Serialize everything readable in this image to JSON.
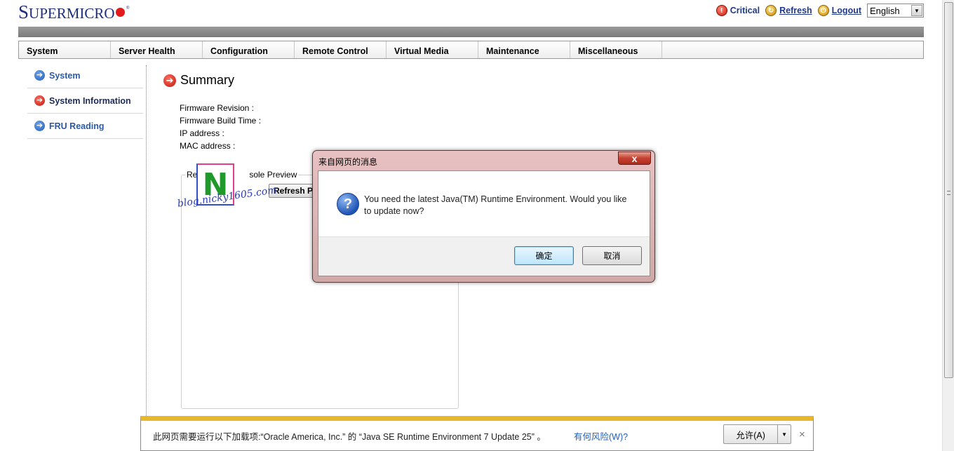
{
  "brand": {
    "letter_s": "S",
    "rest": "UPERMICRO",
    "reg": "®"
  },
  "topbar": {
    "critical": "Critical",
    "refresh": "Refresh",
    "logout": "Logout",
    "language": "English"
  },
  "nav": [
    "System",
    "Server Health",
    "Configuration",
    "Remote Control",
    "Virtual Media",
    "Maintenance",
    "Miscellaneous"
  ],
  "sidebar": [
    {
      "label": "System",
      "icon": "arrow-right-circle-blue-icon"
    },
    {
      "label": "System Information",
      "icon": "arrow-right-circle-red-icon"
    },
    {
      "label": "FRU Reading",
      "icon": "arrow-right-circle-blue-icon"
    }
  ],
  "main": {
    "title": "Summary",
    "fields": [
      "Firmware Revision :",
      "Firmware Build Time :",
      "IP address :",
      "MAC address :"
    ],
    "preview_legend_left": "Re",
    "preview_legend_right": "sole Preview",
    "refresh_preview_button": "Refresh P"
  },
  "watermark": {
    "letter": "N",
    "text": "blog.nicky1605.com"
  },
  "dialog": {
    "title": "来自网页的消息",
    "close": "x",
    "message": "You need the latest Java(TM) Runtime Environment. Would you like to update now?",
    "ok": "确定",
    "cancel": "取消"
  },
  "infobar": {
    "text": "此网页需要运行以下加载项:“Oracle America, Inc.” 的 “Java SE Runtime Environment 7 Update 25” 。",
    "risk_link": "有何风险(W)?",
    "allow": "允许(A)",
    "close": "×"
  },
  "colors": {
    "brand": "#1f2f80",
    "accent_red": "#e21b1b",
    "infobar_accent": "#e8b72a",
    "link": "#1f3a8a"
  }
}
